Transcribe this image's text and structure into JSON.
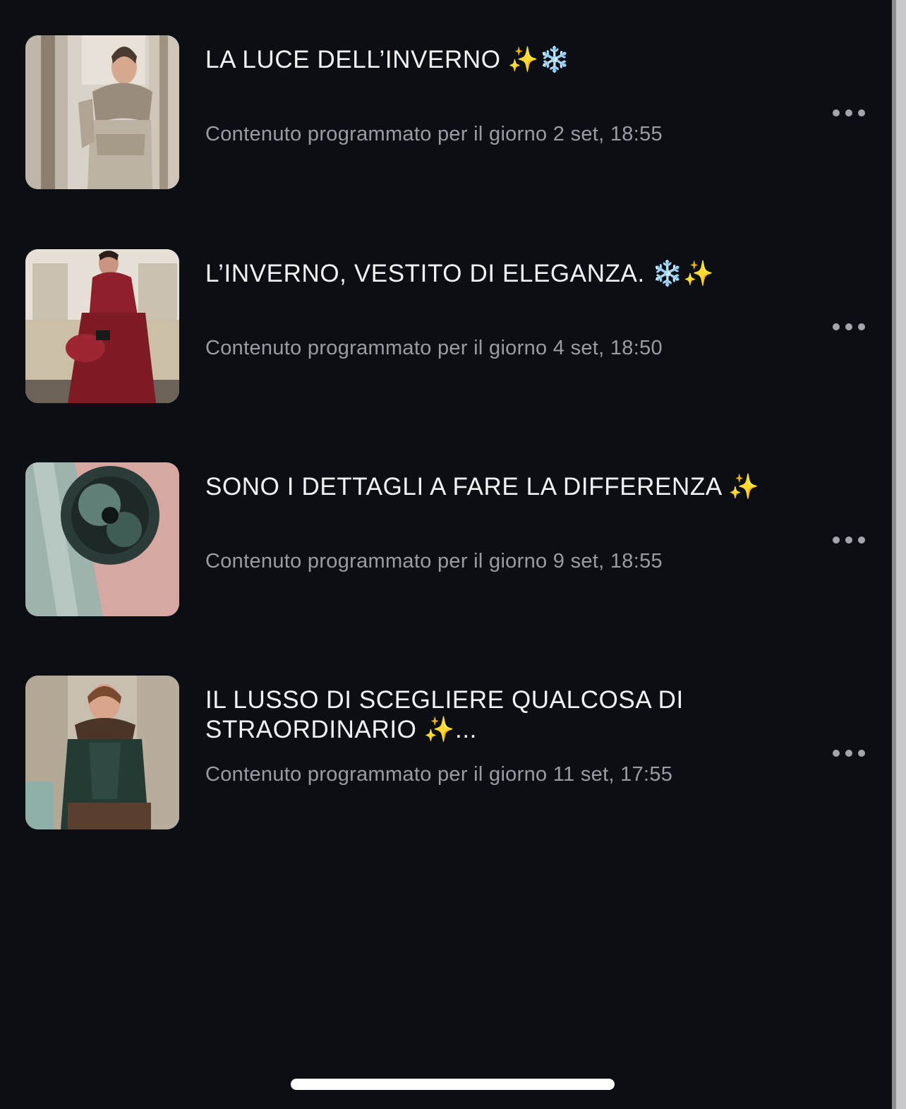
{
  "posts": [
    {
      "title": "LA LUCE DELL’INVERNO ✨❄️",
      "subtitle": "Contenuto programmato per il giorno 2 set, 18:55",
      "thumbnail": "woman-in-snakeskin-jacket-with-fur-collar"
    },
    {
      "title": "L’INVERNO, VESTITO DI ELEGANZA. ❄️✨",
      "subtitle": "Contenuto programmato per il giorno 4 set, 18:50",
      "thumbnail": "woman-in-burgundy-coat-with-fur-collar"
    },
    {
      "title": "SONO I DETTAGLI A FARE LA DIFFERENZA ✨",
      "subtitle": "Contenuto programmato per il giorno 9 set, 18:55",
      "thumbnail": "green-fur-pompom-on-python-leather"
    },
    {
      "title": "IL LUSSO DI SCEGLIERE QUALCOSA DI STRAORDINARIO ✨...",
      "subtitle": "Contenuto programmato per il giorno 11 set, 17:55",
      "thumbnail": "woman-in-green-python-jacket-with-fur"
    }
  ],
  "colors": {
    "background": "#0b0f14",
    "title": "#f2f2f4",
    "subtitle": "#9a9ca3",
    "more_dots": "#a3a5ac"
  },
  "icons": {
    "more": "more-horizontal-icon"
  }
}
